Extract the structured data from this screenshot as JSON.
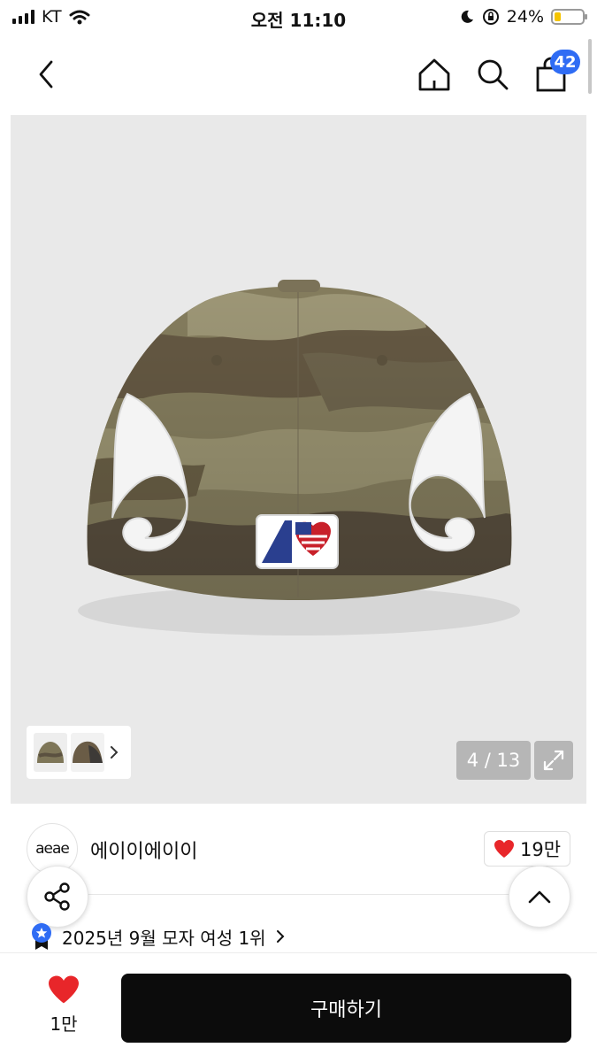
{
  "status_bar": {
    "carrier": "KT",
    "time": "오전 11:10",
    "battery_percent": "24%",
    "battery_level": 0.24
  },
  "nav": {
    "back_icon": "back-chevron-icon",
    "home_icon": "home-icon",
    "search_icon": "search-icon",
    "cart_icon": "shopping-bag-icon",
    "cart_count": "42",
    "badge_color": "#2f6cf4"
  },
  "gallery": {
    "counter": "4 / 13",
    "expand_icon": "expand-icon",
    "thumbs_more_icon": "chevron-right-icon"
  },
  "brand": {
    "logo_text": "aeae",
    "name": "에이이에이이",
    "like_count": "19만"
  },
  "ranking": {
    "icon": "ranking-badge-icon",
    "text": "2025년 9월 모자 여성 1위"
  },
  "actions": {
    "share_icon": "share-icon",
    "scroll_top_icon": "chevron-up-icon"
  },
  "bottom_bar": {
    "wish_count": "1만",
    "buy_label": "구매하기",
    "heart_color": "#e8262a"
  }
}
